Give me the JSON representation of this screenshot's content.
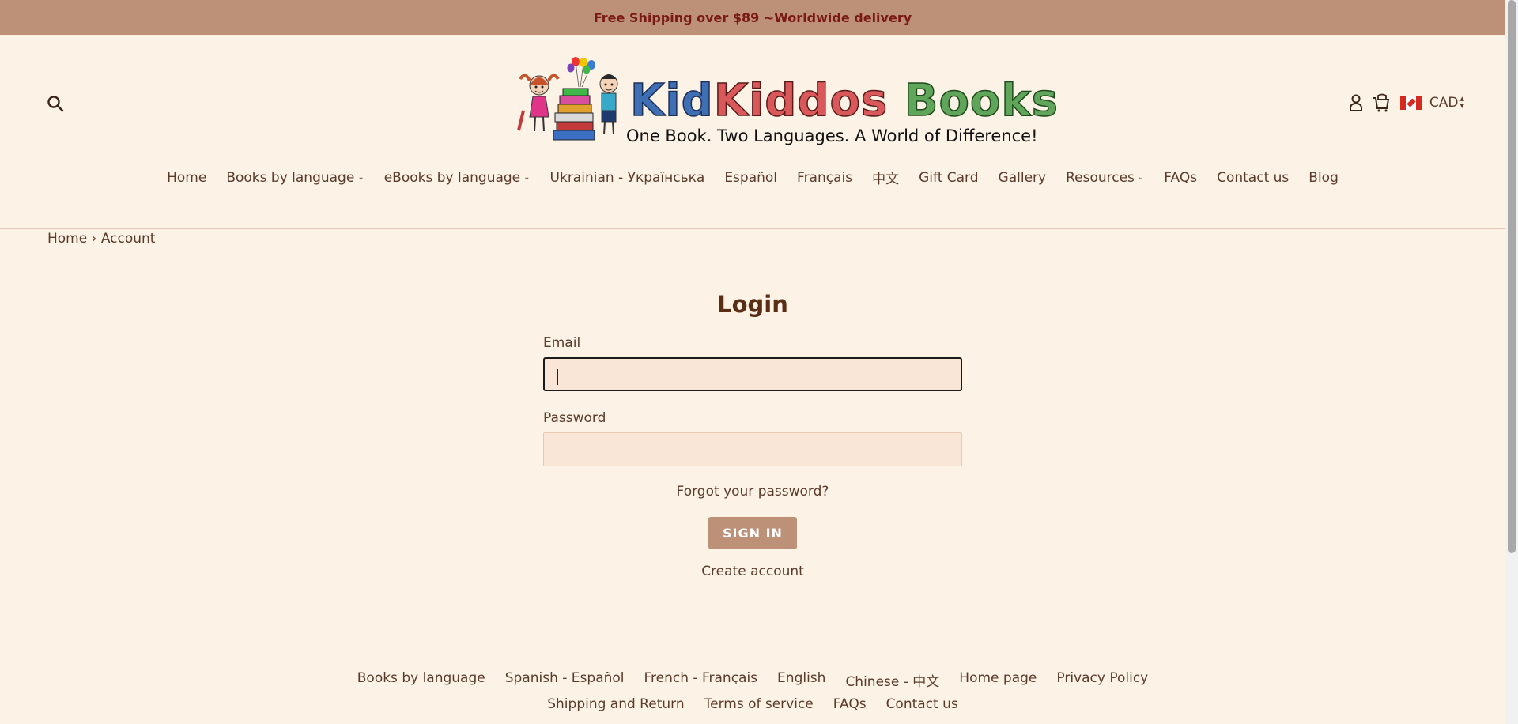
{
  "announcement": "Free Shipping over $89 ~Worldwide delivery",
  "logo": {
    "title_part1": "Kid",
    "title_part2": "Kiddos",
    "title_part3": "Books",
    "tagline": "One Book. Two Languages. A World of Difference!"
  },
  "header": {
    "search_icon": "search-icon",
    "account_icon": "user-icon",
    "cart_icon": "cart-icon",
    "currency": "CAD",
    "flag": "canada-flag"
  },
  "nav": {
    "items": [
      {
        "label": "Home"
      },
      {
        "label": "Books by language",
        "dropdown": "⌄"
      },
      {
        "label": "eBooks by language",
        "dropdown": "⌄"
      },
      {
        "label": "Ukrainian - Українська"
      },
      {
        "label": "Español"
      },
      {
        "label": "Français"
      },
      {
        "label": "中文"
      },
      {
        "label": "Gift Card"
      },
      {
        "label": "Gallery"
      },
      {
        "label": "Resources",
        "dropdown": "⌄"
      },
      {
        "label": "FAQs"
      },
      {
        "label": "Contact us"
      },
      {
        "label": "Blog"
      }
    ]
  },
  "breadcrumb": {
    "home": "Home",
    "separator": "›",
    "current": "Account"
  },
  "login": {
    "title": "Login",
    "email_label": "Email",
    "email_value": "",
    "password_label": "Password",
    "password_value": "",
    "forgot": "Forgot your password?",
    "sign_in": "SIGN IN",
    "create": "Create account"
  },
  "footer": {
    "row1": [
      "Books by language",
      "Spanish - Español",
      "French - Français",
      "English",
      "Chinese - 中文",
      "Home page",
      "Privacy Policy"
    ],
    "row2": [
      "Shipping and Return",
      "Terms of service",
      "FAQs",
      "Contact us"
    ]
  },
  "colors": {
    "background": "#fcf2e6",
    "accent": "#bd9078",
    "announcement_text": "#7a1a14",
    "text": "#5a3a2b"
  }
}
